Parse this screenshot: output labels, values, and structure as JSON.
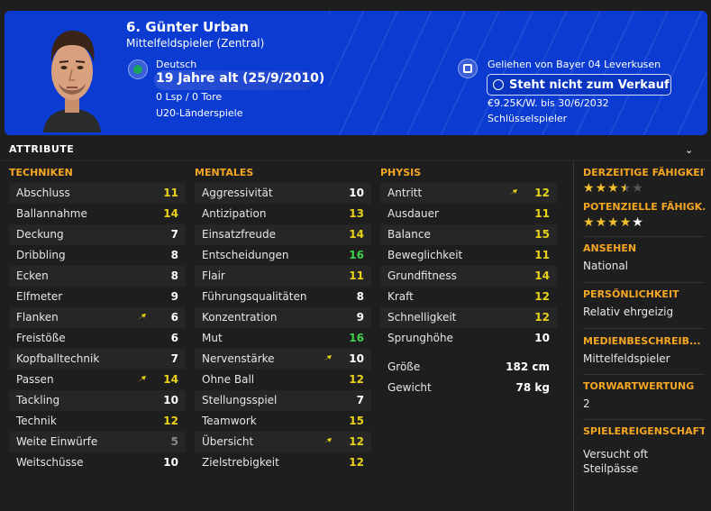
{
  "player": {
    "name": "6. Günter Urban",
    "position": "Mittelfeldspieler (Zentral)",
    "nationality": "Deutsch",
    "age": "19 Jahre alt (25/9/2010)",
    "apps": "0 Lsp / 0 Tore",
    "u20": "U20-Länderspiele",
    "loan": "Geliehen von Bayer 04 Leverkusen",
    "status": "Steht nicht zum Verkauf",
    "wage": "€9.25K/W. bis 30/6/2032",
    "role": "Schlüsselspieler"
  },
  "section": {
    "title": "ATTRIBUTE",
    "chevron": "⌄"
  },
  "columns": {
    "technical": {
      "title": "TECHNIKEN",
      "rows": [
        {
          "name": "Abschluss",
          "value": "11",
          "color": "yellow",
          "arrow": false
        },
        {
          "name": "Ballannahme",
          "value": "14",
          "color": "yellow",
          "arrow": false
        },
        {
          "name": "Deckung",
          "value": "7",
          "color": "white",
          "arrow": false
        },
        {
          "name": "Dribbling",
          "value": "8",
          "color": "white",
          "arrow": false
        },
        {
          "name": "Ecken",
          "value": "8",
          "color": "white",
          "arrow": false
        },
        {
          "name": "Elfmeter",
          "value": "9",
          "color": "white",
          "arrow": false
        },
        {
          "name": "Flanken",
          "value": "6",
          "color": "white",
          "arrow": true
        },
        {
          "name": "Freistöße",
          "value": "6",
          "color": "white",
          "arrow": false
        },
        {
          "name": "Kopfballtechnik",
          "value": "7",
          "color": "white",
          "arrow": false
        },
        {
          "name": "Passen",
          "value": "14",
          "color": "yellow",
          "arrow": true
        },
        {
          "name": "Tackling",
          "value": "10",
          "color": "white",
          "arrow": false
        },
        {
          "name": "Technik",
          "value": "12",
          "color": "yellow",
          "arrow": false
        },
        {
          "name": "Weite Einwürfe",
          "value": "5",
          "color": "grey",
          "arrow": false
        },
        {
          "name": "Weitschüsse",
          "value": "10",
          "color": "white",
          "arrow": false
        }
      ]
    },
    "mental": {
      "title": "MENTALES",
      "rows": [
        {
          "name": "Aggressivität",
          "value": "10",
          "color": "white",
          "arrow": false
        },
        {
          "name": "Antizipation",
          "value": "13",
          "color": "yellow",
          "arrow": false
        },
        {
          "name": "Einsatzfreude",
          "value": "14",
          "color": "yellow",
          "arrow": false
        },
        {
          "name": "Entscheidungen",
          "value": "16",
          "color": "green",
          "arrow": false
        },
        {
          "name": "Flair",
          "value": "11",
          "color": "yellow",
          "arrow": false
        },
        {
          "name": "Führungsqualitäten",
          "value": "8",
          "color": "white",
          "arrow": false
        },
        {
          "name": "Konzentration",
          "value": "9",
          "color": "white",
          "arrow": false
        },
        {
          "name": "Mut",
          "value": "16",
          "color": "green",
          "arrow": false
        },
        {
          "name": "Nervenstärke",
          "value": "10",
          "color": "white",
          "arrow": true
        },
        {
          "name": "Ohne Ball",
          "value": "12",
          "color": "yellow",
          "arrow": false
        },
        {
          "name": "Stellungsspiel",
          "value": "7",
          "color": "white",
          "arrow": false
        },
        {
          "name": "Teamwork",
          "value": "15",
          "color": "yellow",
          "arrow": false
        },
        {
          "name": "Übersicht",
          "value": "12",
          "color": "yellow",
          "arrow": true
        },
        {
          "name": "Zielstrebigkeit",
          "value": "12",
          "color": "yellow",
          "arrow": false
        }
      ]
    },
    "physical": {
      "title": "PHYSIS",
      "rows": [
        {
          "name": "Antritt",
          "value": "12",
          "color": "yellow",
          "arrow": true
        },
        {
          "name": "Ausdauer",
          "value": "11",
          "color": "yellow",
          "arrow": false
        },
        {
          "name": "Balance",
          "value": "15",
          "color": "yellow",
          "arrow": false
        },
        {
          "name": "Beweglichkeit",
          "value": "11",
          "color": "yellow",
          "arrow": false
        },
        {
          "name": "Grundfitness",
          "value": "14",
          "color": "yellow",
          "arrow": false
        },
        {
          "name": "Kraft",
          "value": "12",
          "color": "yellow",
          "arrow": false
        },
        {
          "name": "Schnelligkeit",
          "value": "12",
          "color": "yellow",
          "arrow": false
        },
        {
          "name": "Sprunghöhe",
          "value": "10",
          "color": "white",
          "arrow": false
        }
      ],
      "extra": [
        {
          "name": "Größe",
          "value": "182 cm"
        },
        {
          "name": "Gewicht",
          "value": "78 kg"
        }
      ]
    }
  },
  "sidebar": {
    "current_ability": {
      "label": "DERZEITIGE FÄHIGKEIT",
      "stars": 3.5,
      "max": 5
    },
    "potential_ability": {
      "label": "POTENZIELLE FÄHIGK...",
      "stars": 4,
      "max": 5
    },
    "reputation": {
      "label": "ANSEHEN",
      "value": "National"
    },
    "personality": {
      "label": "PERSÖNLICHKEIT",
      "value": "Relativ ehrgeizig"
    },
    "media": {
      "label": "MEDIENBESCHREIB...",
      "value": "Mittelfeldspieler"
    },
    "gk_rating": {
      "label": "TORWARTWERTUNG",
      "value": "2"
    },
    "traits": {
      "label": "SPIELEREIGENSCHAFT",
      "values": [
        "Versucht oft",
        "Steilpässe"
      ]
    }
  },
  "colors": {
    "header_bg": "#0b3bd1",
    "accent": "#f5a623",
    "yellow": "#e8d21a",
    "green": "#3dd14a"
  },
  "icons": {
    "arrow": "up-right-arrow-icon",
    "nation": "dfb-badge-icon",
    "club": "club-badge-icon",
    "status": "info-circle-icon"
  }
}
